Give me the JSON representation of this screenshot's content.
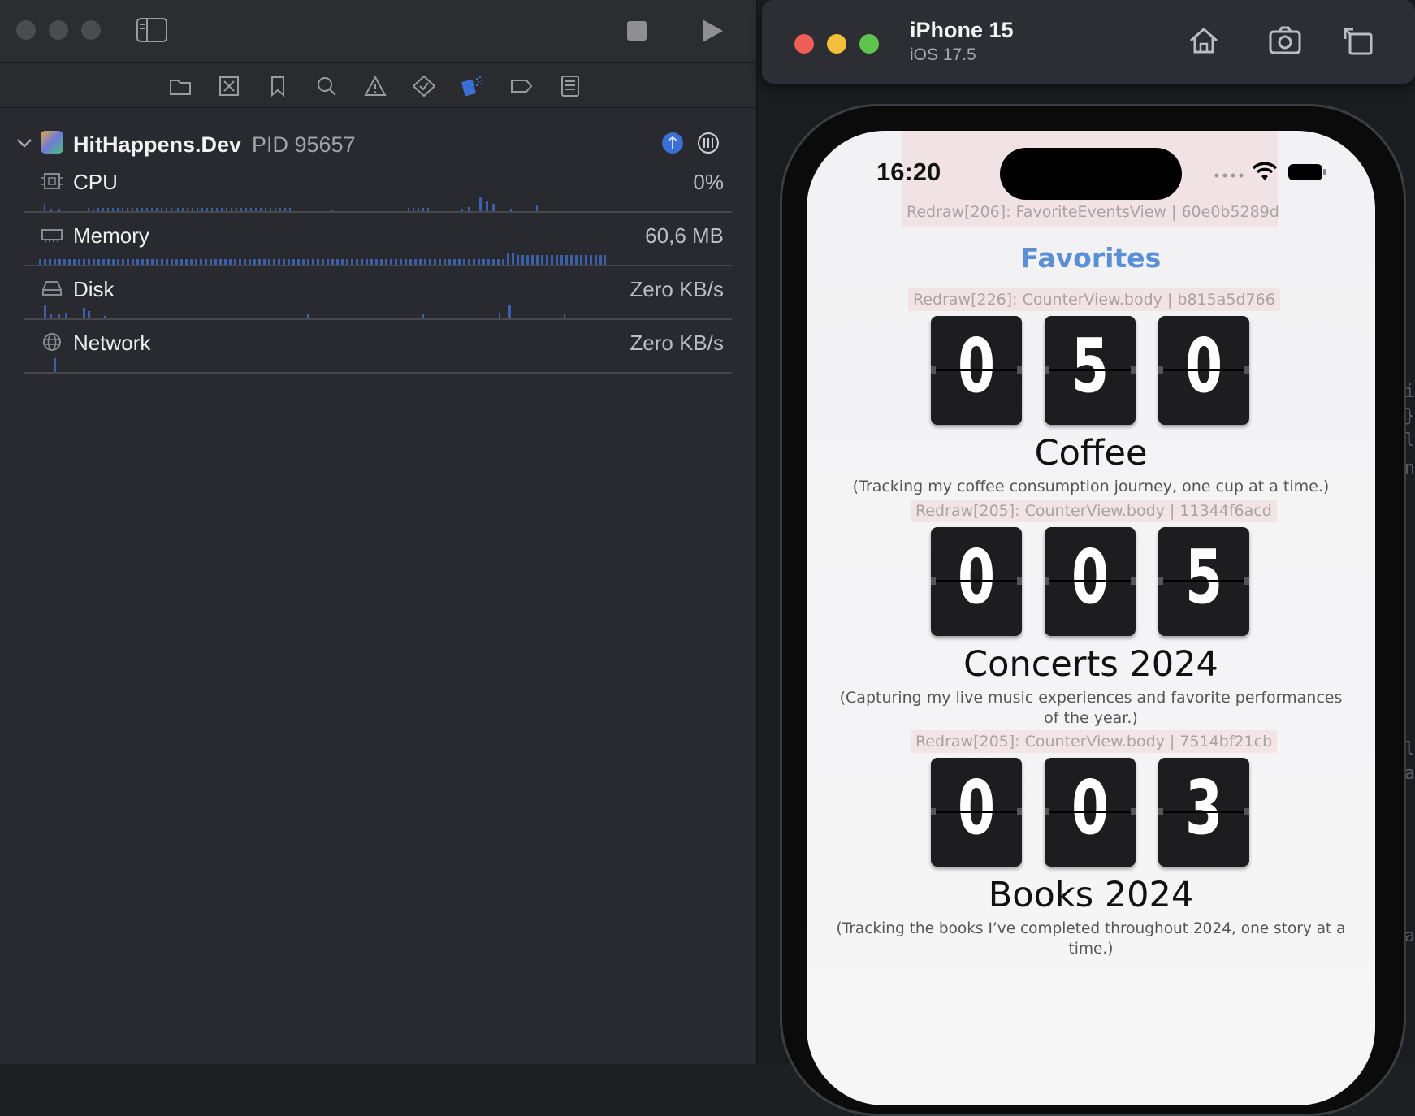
{
  "xcode": {
    "process": {
      "name": "HitHappens.Dev",
      "pid": "PID 95657"
    },
    "gauges": [
      {
        "label": "CPU",
        "value": "0%",
        "icon": "cpu-icon"
      },
      {
        "label": "Memory",
        "value": "60,6 MB",
        "icon": "memory-icon"
      },
      {
        "label": "Disk",
        "value": "Zero KB/s",
        "icon": "disk-icon"
      },
      {
        "label": "Network",
        "value": "Zero KB/s",
        "icon": "network-icon"
      }
    ],
    "accent": "#3b6fd4"
  },
  "simulator": {
    "device": "iPhone 15",
    "os": "iOS 17.5"
  },
  "phone": {
    "time": "16:20",
    "redraw_view": "Redraw[206]: FavoriteEventsView | 60e0b5289d",
    "title": "Favorites",
    "counters": [
      {
        "redraw": "Redraw[226]: CounterView.body | b815a5d766",
        "digits": [
          "0",
          "5",
          "0"
        ],
        "title": "Coffee",
        "description": "(Tracking my coffee consumption journey, one cup at a time.)"
      },
      {
        "redraw": "Redraw[205]: CounterView.body | 11344f6acd",
        "digits": [
          "0",
          "0",
          "5"
        ],
        "title": "Concerts 2024",
        "description": "(Capturing my live music experiences and favorite performances of the year.)"
      },
      {
        "redraw": "Redraw[205]: CounterView.body | 7514bf21cb",
        "digits": [
          "0",
          "0",
          "3"
        ],
        "title": "Books 2024",
        "description": "(Tracking the books I’ve completed throughout 2024, one story at a time.)"
      }
    ]
  }
}
